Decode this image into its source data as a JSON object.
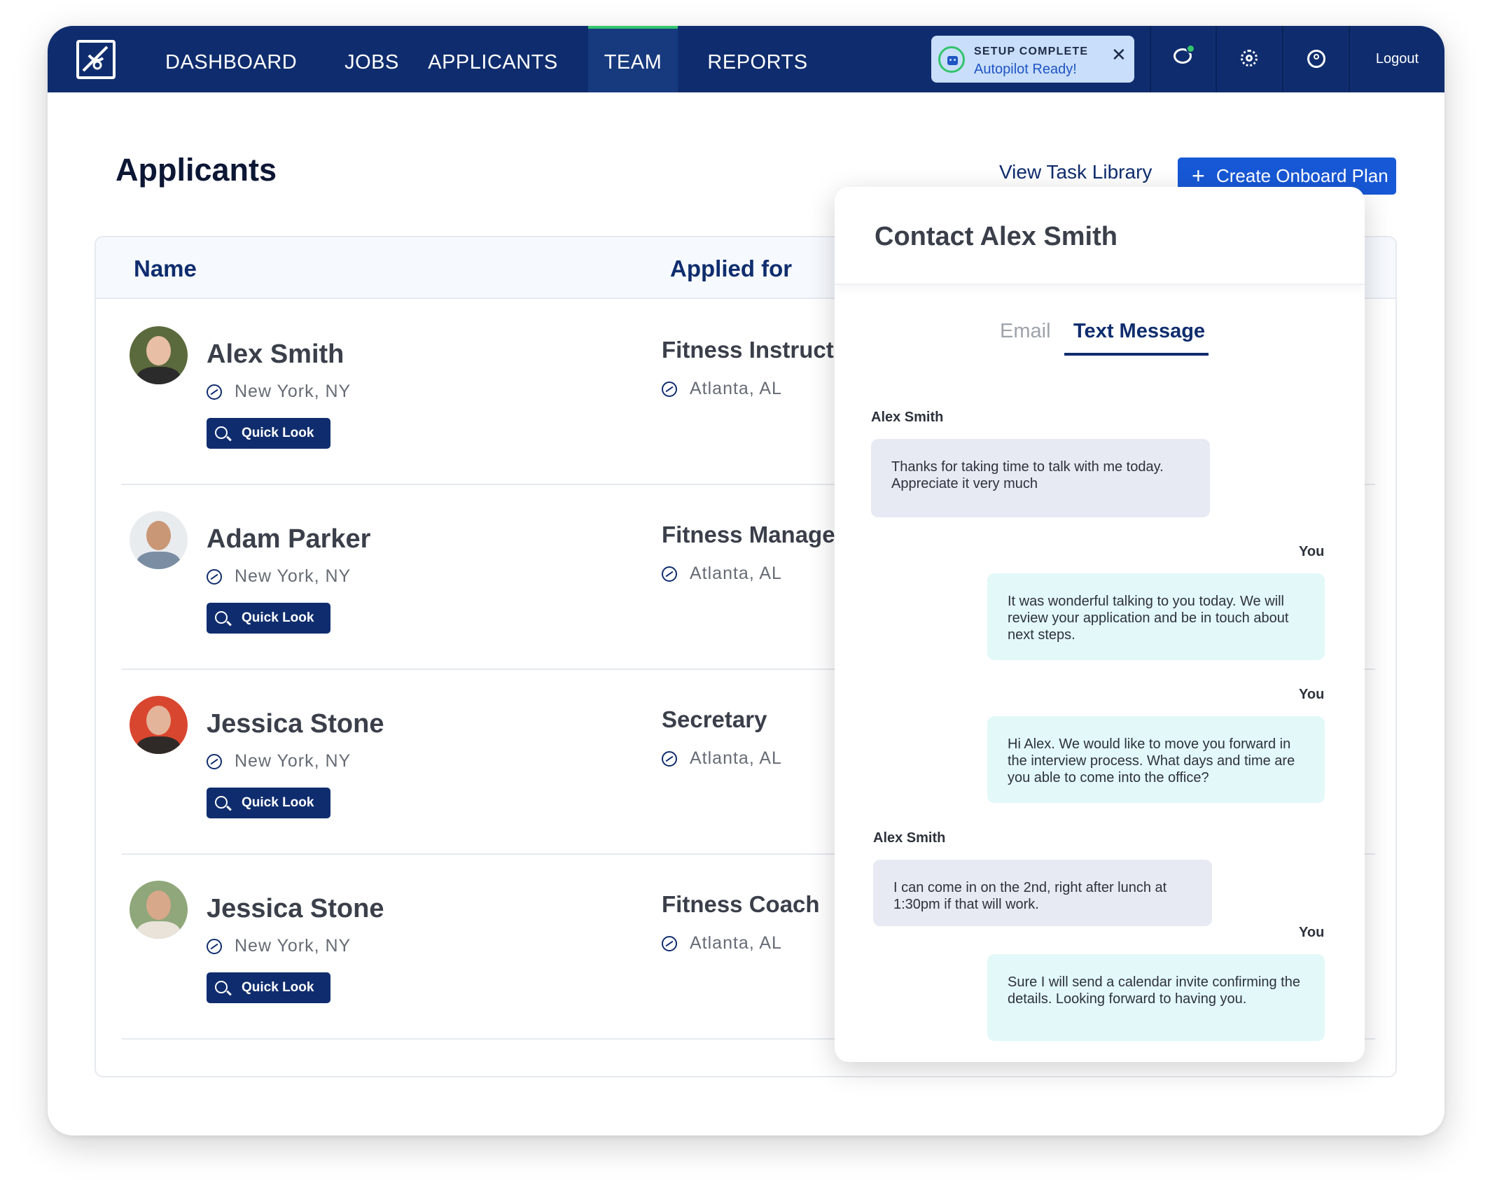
{
  "nav": {
    "items": [
      {
        "label": "DASHBOARD"
      },
      {
        "label": "JOBS"
      },
      {
        "label": "APPLICANTS"
      },
      {
        "label": "TEAM",
        "active": true
      },
      {
        "label": "REPORTS"
      }
    ],
    "setup_banner": {
      "title": "SETUP COMPLETE",
      "subtitle": "Autopilot Ready!"
    },
    "logout_label": "Logout"
  },
  "page": {
    "title": "Applicants",
    "task_link": "View Task Library",
    "create_button": "Create Onboard Plan",
    "create_icon": "+"
  },
  "table": {
    "headers": {
      "name": "Name",
      "applied_for": "Applied for"
    },
    "rows": [
      {
        "name": "Alex Smith",
        "location": "New York, NY",
        "job": "Fitness Instructor",
        "job_location": "Atlanta, AL",
        "action": "Quick Look"
      },
      {
        "name": "Adam Parker",
        "location": "New York, NY",
        "job": "Fitness Manager",
        "job_location": "Atlanta, AL",
        "action": "Quick Look"
      },
      {
        "name": "Jessica Stone",
        "location": "New York, NY",
        "job": "Secretary",
        "job_location": "Atlanta, AL",
        "action": "Quick Look"
      },
      {
        "name": "Jessica Stone",
        "location": "New York, NY",
        "job": "Fitness Coach",
        "job_location": "Atlanta, AL",
        "action": "Quick Look"
      }
    ]
  },
  "contact": {
    "title": "Contact Alex Smith",
    "tabs": {
      "email": "Email",
      "sms": "Text Message"
    },
    "active_tab": "Text Message",
    "messages": [
      {
        "sender": "Alex Smith",
        "text": "Thanks for taking time to talk with me today. Appreciate it very much"
      },
      {
        "sender": "You",
        "text": "It was wonderful talking to you today. We will review your application and be in touch about next steps."
      },
      {
        "sender": "You",
        "text": "Hi Alex. We would like to move you forward in the interview process. What days and time are you able to come into the office?"
      },
      {
        "sender": "Alex Smith",
        "text": "I can come in on the 2nd, right after lunch at 1:30pm if that will work."
      },
      {
        "sender": "You",
        "text": "Sure I will send a calendar invite confirming the details. Looking forward to having you."
      }
    ]
  },
  "colors": {
    "nav_bg": "#0f2d6e",
    "accent_blue": "#1758d6",
    "status_green": "#32c46b",
    "incoming_bubble": "#e7e9f3",
    "outgoing_bubble": "#e3f8f9"
  },
  "icons": [
    "logo-icon",
    "robot-icon",
    "close-icon",
    "chat-icon",
    "gear-icon",
    "user-icon",
    "location-icon",
    "zoom-in-icon",
    "plus-icon"
  ]
}
